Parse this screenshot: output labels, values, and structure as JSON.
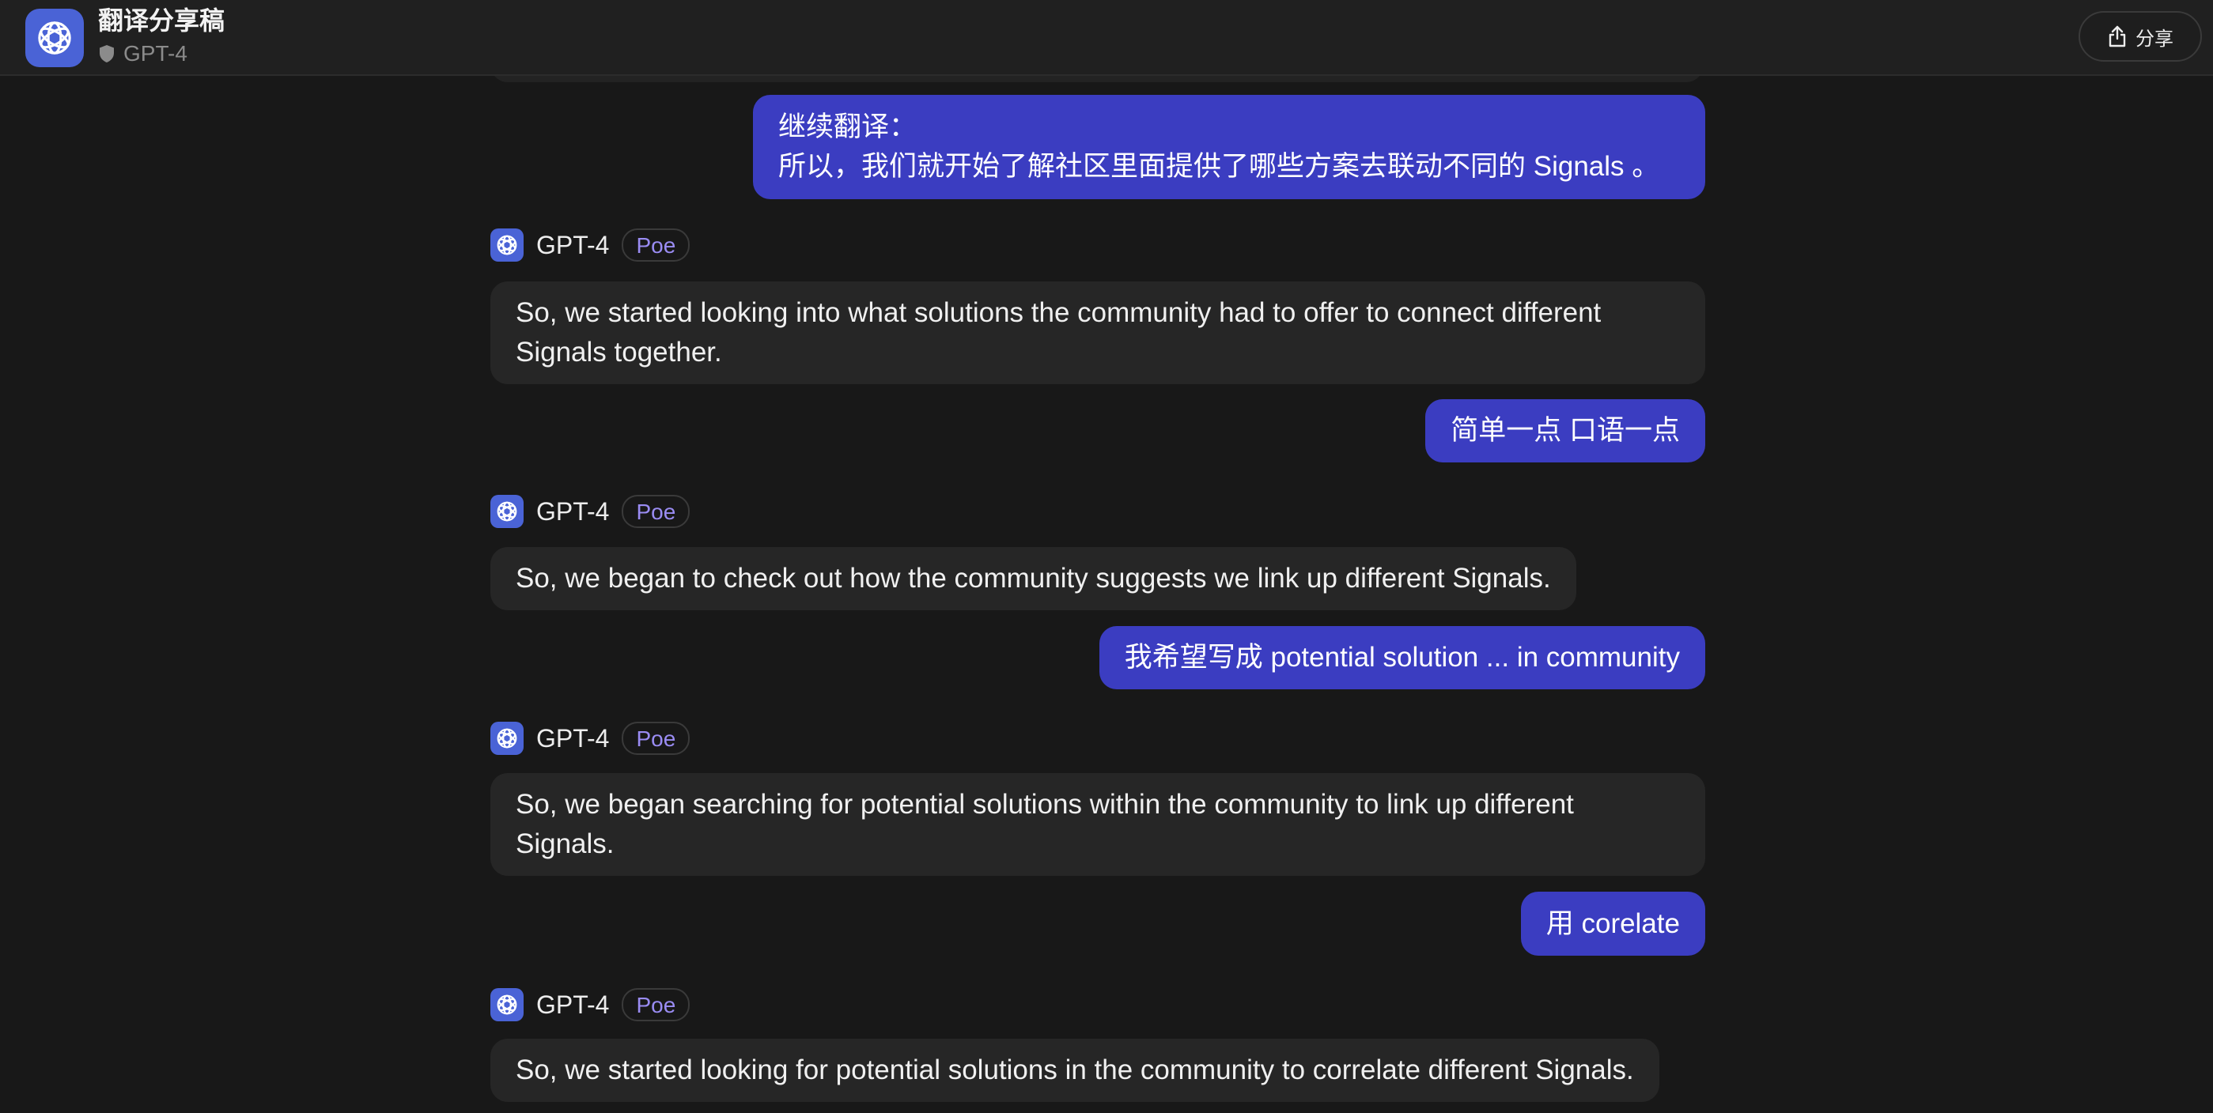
{
  "header": {
    "title": "翻译分享稿",
    "bot_name": "GPT-4",
    "share_label": "分享"
  },
  "messages": {
    "user1": "继续翻译：\n所以，我们就开始了解社区里面提供了哪些方案去联动不同的 Signals 。",
    "bot1": {
      "name": "GPT-4",
      "badge": "Poe",
      "text": "So, we started looking into what solutions the community had to offer to connect different Signals together."
    },
    "user2": "简单一点 口语一点",
    "bot2": {
      "name": "GPT-4",
      "badge": "Poe",
      "text": "So, we began to check out how the community suggests we link up different Signals."
    },
    "user3": "我希望写成 potential solution ... in community",
    "bot3": {
      "name": "GPT-4",
      "badge": "Poe",
      "text": "So, we began searching for potential solutions within the community to link up different Signals."
    },
    "user4": "用 corelate",
    "bot4": {
      "name": "GPT-4",
      "badge": "Poe",
      "text": "So, we started looking for potential solutions in the community to correlate different Signals."
    }
  },
  "icons": {
    "app_logo": "openai-logo-icon",
    "bot_avatar": "openai-logo-icon",
    "verified": "shield-icon",
    "share": "share-icon"
  },
  "colors": {
    "background": "#181818",
    "user_bubble": "#3b3dc1",
    "bot_bubble": "#262626",
    "accent": "#4a63d6",
    "badge_text": "#9a8cf3"
  }
}
